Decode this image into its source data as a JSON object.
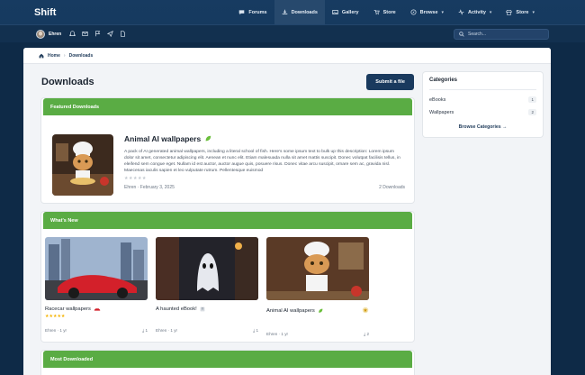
{
  "header": {
    "logo": "Shift",
    "nav": [
      {
        "label": "Forums",
        "icon": "chat-icon",
        "dropdown": false
      },
      {
        "label": "Downloads",
        "icon": "download-icon",
        "dropdown": false,
        "active": true
      },
      {
        "label": "Gallery",
        "icon": "image-icon",
        "dropdown": false
      },
      {
        "label": "Store",
        "icon": "cart-icon",
        "dropdown": false
      },
      {
        "label": "Browse",
        "icon": "compass-icon",
        "dropdown": true
      },
      {
        "label": "Activity",
        "icon": "activity-icon",
        "dropdown": true
      },
      {
        "label": "Store",
        "icon": "store-icon",
        "dropdown": true
      }
    ]
  },
  "userbar": {
    "username": "Ehren",
    "icons": [
      "bell-icon",
      "mail-icon",
      "flag-icon",
      "send-icon",
      "document-icon"
    ],
    "search_placeholder": "Search..."
  },
  "breadcrumb": {
    "home": "Home",
    "current": "Downloads"
  },
  "page": {
    "title": "Downloads",
    "submit_button": "Submit a file"
  },
  "featured": {
    "header": "Featured Downloads",
    "title": "Animal AI wallpapers",
    "description": "A pack of AI generated animal wallpapers, including a literal school of fish. Here's some ipsum text to bulk up this description: Lorem ipsum dolor sit amet, consectetur adipiscing elit. Aenean et nunc elit. Etiam malesuada nulla sit amet mattis suscipit. Donec volutpat facilisis tellus, in eleifend sem congue eget. Nullam id est auctor, auctor augue quis, posuere risus. Donec vitae arcu suscipit, ornare sem ac, gravida nisl. Maecenas iaculis sapien et leo vulputate rutrum. Pellentesque euismod",
    "stars": "★★★★★",
    "author": "Ehren",
    "date": "February 3, 2025",
    "downloads": "2 Downloads"
  },
  "whats_new": {
    "header": "What's New",
    "cards": [
      {
        "title": "Racecar wallpapers",
        "stars": "★★★★★",
        "author": "Ehren",
        "age": "1 yr",
        "downloads": "1"
      },
      {
        "title": "A haunted eBook!",
        "stars": "",
        "author": "Ehren",
        "age": "1 yr",
        "downloads": "1"
      },
      {
        "title": "Animal AI wallpapers",
        "stars": "",
        "author": "Ehren",
        "age": "1 yr",
        "downloads": "2"
      }
    ]
  },
  "most_downloaded": {
    "header": "Most Downloaded"
  },
  "categories": {
    "title": "Categories",
    "items": [
      {
        "label": "eBooks",
        "count": "1"
      },
      {
        "label": "Wallpapers",
        "count": "2"
      }
    ],
    "browse": "Browse Categories"
  },
  "colors": {
    "nav_bg": "#173b61",
    "accent_green": "#5aac44",
    "button": "#1a3a5e"
  }
}
